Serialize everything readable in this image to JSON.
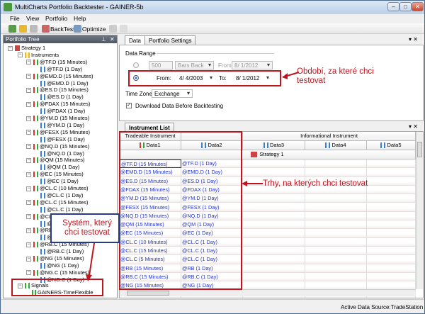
{
  "window": {
    "title": "MultiCharts Portfolio Backtester - GAINER-5b",
    "min_icon": "minimize-icon",
    "max_icon": "maximize-icon",
    "close_icon": "close-icon"
  },
  "menu": [
    "File",
    "View",
    "Portfolio",
    "Help"
  ],
  "toolbar": {
    "backtest": "BackTest",
    "optimize": "Optimize"
  },
  "tree": {
    "header": "Portfolio Tree",
    "strategy": "Strategy 1",
    "instruments_label": "Instruments",
    "instruments": [
      [
        "@TF.D (15 Minutes)",
        "@TF.D (1 Day)"
      ],
      [
        "@EMD.D (15 Minutes)",
        "@EMD.D (1 Day)"
      ],
      [
        "@ES.D (15 Minutes)",
        "@ES.D (1 Day)"
      ],
      [
        "@FDAX (15 Minutes)",
        "@FDAX (1 Day)"
      ],
      [
        "@YM.D (15 Minutes)",
        "@YM.D (1 Day)"
      ],
      [
        "@FESX (15 Minutes)",
        "@FESX (1 Day)"
      ],
      [
        "@NQ.D (15 Minutes)",
        "@NQ.D (1 Day)"
      ],
      [
        "@QM (15 Minutes)",
        "@QM (1 Day)"
      ],
      [
        "@EC (15 Minutes)",
        "@EC (1 Day)"
      ],
      [
        "@CL.C (10 Minutes)",
        "@CL.C (1 Day)"
      ],
      [
        "@CL.C (15 Minutes)",
        "@CL.C (1 Day)"
      ],
      [
        "@CL.C (5 Minutes)",
        "@CL.C (1 Day)"
      ],
      [
        "@RB (15 Minutes)",
        "@RB (1 Day)"
      ],
      [
        "@RB.C (15 Minutes)",
        "@RB.C (1 Day)"
      ],
      [
        "@NG (15 Minutes)",
        "@NG (1 Day)"
      ],
      [
        "@NG.C (15 Minutes)",
        "@NG.C (1 Day)"
      ]
    ],
    "signals_label": "Signals",
    "signal": "GAINERS-TimeFlexible"
  },
  "data_tabs": [
    "Data",
    "Portfolio Settings"
  ],
  "data_range": {
    "label": "Data Range",
    "bars_value": "500",
    "bars_unit": "Bars Back",
    "from_label": "From:",
    "bars_from_date": "8/ 1/2012",
    "range_from_label": "From:",
    "range_from": "4/ 4/2003",
    "to_label": "To:",
    "range_to": "8/ 1/2012",
    "timezone_label": "Time Zone:",
    "timezone": "Exchange",
    "download_label": "Download Data Before Backtesting",
    "download_checked": true
  },
  "instrument_list": {
    "tab": "Instrument List",
    "group_tradeable": "Tradeable Instrument",
    "group_informational": "Informational Instrument",
    "columns": [
      "Data1",
      "Data2",
      "Data3",
      "Data4",
      "Data5"
    ],
    "strategy_row": "Strategy 1",
    "rows": [
      [
        "@TF.D (15 Minutes)",
        "@TF.D (1 Day)"
      ],
      [
        "@EMD.D (15 Minutes)",
        "@EMD.D (1 Day)"
      ],
      [
        "@ES.D (15 Minutes)",
        "@ES.D (1 Day)"
      ],
      [
        "@FDAX (15 Minutes)",
        "@FDAX (1 Day)"
      ],
      [
        "@YM.D (15 Minutes)",
        "@YM.D (1 Day)"
      ],
      [
        "@FESX (15 Minutes)",
        "@FESX (1 Day)"
      ],
      [
        "@NQ.D (15 Minutes)",
        "@NQ.D (1 Day)"
      ],
      [
        "@QM (15 Minutes)",
        "@QM (1 Day)"
      ],
      [
        "@EC (15 Minutes)",
        "@EC (1 Day)"
      ],
      [
        "@CL.C (10 Minutes)",
        "@CL.C (1 Day)"
      ],
      [
        "@CL.C (15 Minutes)",
        "@CL.C (1 Day)"
      ],
      [
        "@CL.C (5 Minutes)",
        "@CL.C (1 Day)"
      ],
      [
        "@RB (15 Minutes)",
        "@RB (1 Day)"
      ],
      [
        "@RB.C (15 Minutes)",
        "@RB.C (1 Day)"
      ],
      [
        "@NG (15 Minutes)",
        "@NG (1 Day)"
      ]
    ]
  },
  "status": "Active Data Source:TradeStation",
  "annotations": {
    "period": "Období, za které chci testovat",
    "markets": "Trhy, na kterých chci testovat",
    "system": "Systém, který chci testovat"
  },
  "colors": {
    "annotation": "#c0141e",
    "link": "#2233cc"
  }
}
